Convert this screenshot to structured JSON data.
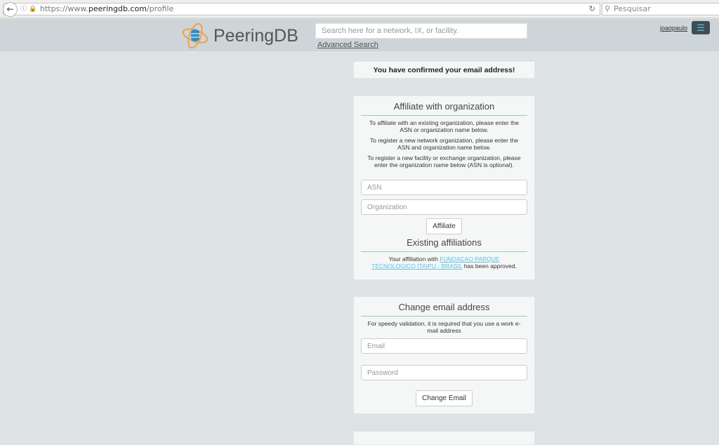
{
  "browser": {
    "url_prefix": "https://www.",
    "url_domain": "peeringdb.com",
    "url_path": "/profile",
    "search_placeholder": "Pesquisar"
  },
  "header": {
    "logo": "PeeringDB",
    "search_placeholder": "Search here for a network, IX, or facility.",
    "advanced_search": "Advanced Search",
    "username": "joaopaulo"
  },
  "confirm_message": "You have confirmed your email address!",
  "affiliate": {
    "title": "Affiliate with organization",
    "p1": "To affiliate with an existing organization, please enter the ASN or organization name below.",
    "p2": "To register a new network organization, please enter the ASN and organization name below.",
    "p3": "To register a new facility or exchange organization, please enter the organization name below (ASN is optional).",
    "asn_placeholder": "ASN",
    "org_placeholder": "Organization",
    "button": "Affiliate"
  },
  "existing": {
    "title": "Existing affiliations",
    "prefix": "Your affiliation with ",
    "org": "FUNDACAO PARQUE TECNOLOGICO ITAIPU - BRASIL",
    "suffix": " has been approved."
  },
  "email": {
    "title": "Change email address",
    "note": "For speedy validation, it is required that you use a work e-mail address",
    "email_placeholder": "Email",
    "password_placeholder": "Password",
    "button": "Change Email"
  },
  "colors": {
    "accent": "#5bc0de",
    "header_bg": "#cdd5d8",
    "page_bg": "#dde3e4"
  }
}
